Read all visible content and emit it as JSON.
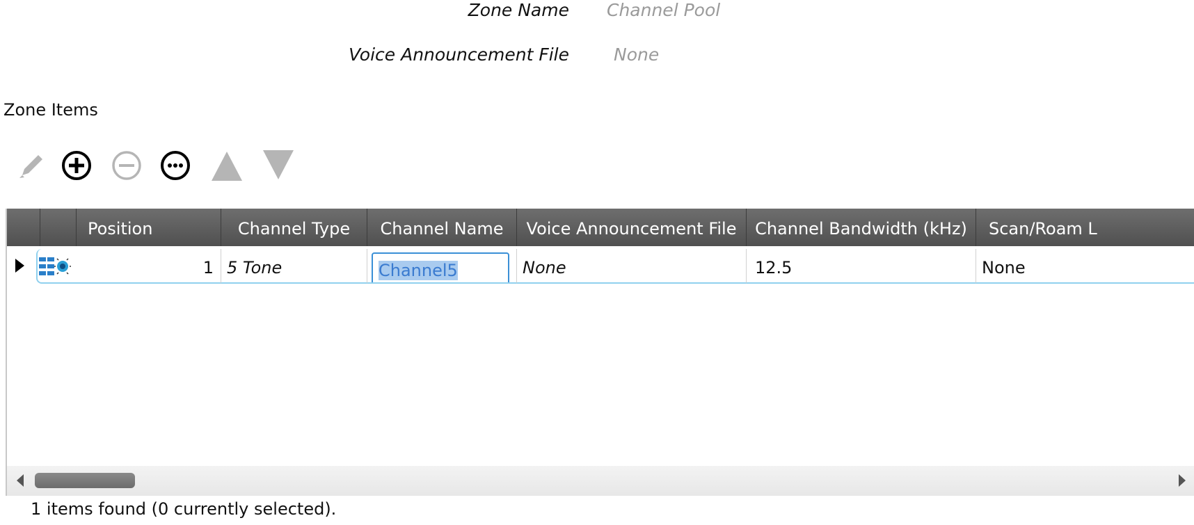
{
  "form": {
    "zone_name_label": "Zone Name",
    "zone_name_value": "Channel Pool",
    "voice_file_label": "Voice Announcement File",
    "voice_file_value": "None"
  },
  "section_title": "Zone Items",
  "toolbar": [
    {
      "icon": "pencil-icon",
      "enabled": false
    },
    {
      "icon": "add-circle-icon",
      "enabled": true
    },
    {
      "icon": "remove-circle-icon",
      "enabled": false
    },
    {
      "icon": "more-circle-icon",
      "enabled": true
    },
    {
      "icon": "move-up-icon",
      "enabled": false
    },
    {
      "icon": "move-down-icon",
      "enabled": false
    }
  ],
  "grid": {
    "columns": [
      "",
      "",
      "Position",
      "Channel Type",
      "Channel Name",
      "Voice Announcement File",
      "Channel Bandwidth (kHz)",
      "Scan/Roam L"
    ],
    "rows": [
      {
        "icon": "channel-pool-icon",
        "position": "1",
        "channel_type": "5 Tone",
        "channel_name": "Channel5",
        "voice_file": "None",
        "bandwidth": "12.5",
        "scan_roam": "None"
      }
    ]
  },
  "status": "1 items found (0 currently selected).",
  "colors": {
    "header_bg": "#5a5a5a",
    "row_border": "#8fd0ee",
    "edit_border": "#3a8fd6",
    "selection": "#a9cbef",
    "disabled_icon": "#b5b5b5"
  }
}
